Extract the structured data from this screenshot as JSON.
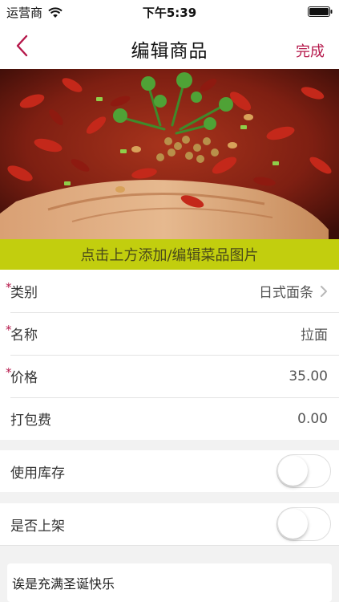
{
  "status_bar": {
    "carrier": "运营商",
    "time": "下午5:39",
    "wifi_icon": "wifi-icon",
    "battery_icon": "battery-icon"
  },
  "nav": {
    "back_icon": "chevron-left-icon",
    "title": "编辑商品",
    "done_label": "完成",
    "accent_color": "#b5174a"
  },
  "photo": {
    "banner_label": "点击上方添加/编辑菜品图片",
    "banner_color": "#c2ce0e"
  },
  "form": {
    "required_mark": "*",
    "category": {
      "label": "类别",
      "value": "日式面条",
      "required": true
    },
    "name": {
      "label": "名称",
      "value": "拉面",
      "required": true
    },
    "price": {
      "label": "价格",
      "value": "35.00",
      "required": true
    },
    "packing_fee": {
      "label": "打包费",
      "value": "0.00",
      "required": false
    }
  },
  "toggles": {
    "use_stock": {
      "label": "使用库存",
      "on": false
    },
    "on_shelf": {
      "label": "是否上架",
      "on": false
    }
  },
  "description": {
    "value": "诶是充满圣诞快乐"
  }
}
